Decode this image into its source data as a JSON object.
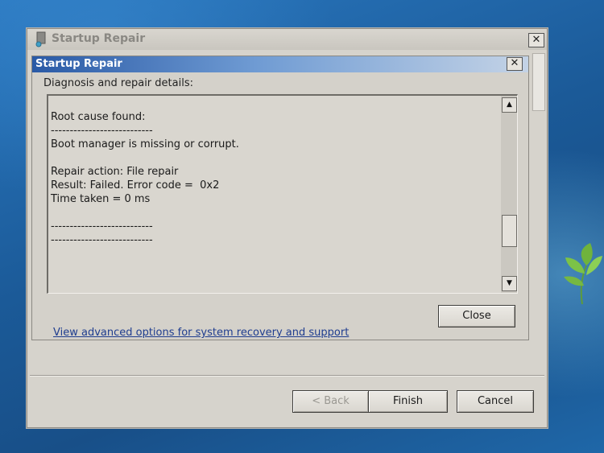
{
  "outer_window": {
    "title": "Startup Repair",
    "close_glyph": "✕",
    "icon": "startup-repair-app-icon"
  },
  "inner_dialog": {
    "title": "Startup Repair",
    "close_glyph": "✕",
    "details_label": "Diagnosis and repair details:",
    "details_lines": [
      "Root cause found:",
      "---------------------------",
      "Boot manager is missing or corrupt.",
      "",
      "Repair action: File repair",
      "Result: Failed. Error code =  0x2",
      "Time taken = 0 ms",
      "",
      "---------------------------",
      "---------------------------"
    ],
    "scroll_up_glyph": "▲",
    "scroll_down_glyph": "▼",
    "close_button_label": "Close"
  },
  "advanced_link": "View advanced options for system recovery and support",
  "footer": {
    "back_label": "< Back",
    "finish_label": "Finish",
    "cancel_label": "Cancel"
  },
  "colors": {
    "title_bar_gradient_start": "#2a5aa6",
    "link": "#1f3d8f",
    "desktop": "#1d5e9c"
  }
}
